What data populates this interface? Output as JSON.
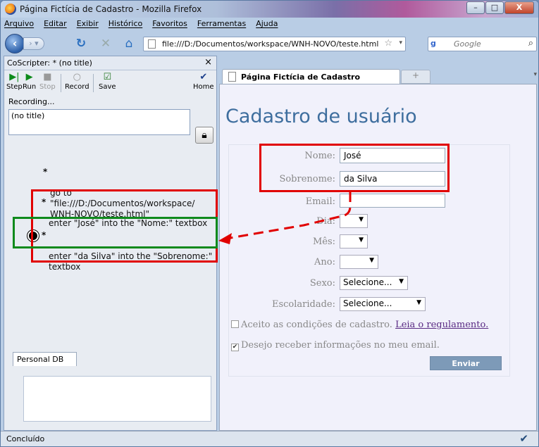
{
  "window": {
    "title": "Página Fictícia de Cadastro - Mozilla Firefox",
    "minimize": "–",
    "maximize": "□",
    "close": "X"
  },
  "menu": [
    "Arquivo",
    "Editar",
    "Exibir",
    "Histórico",
    "Favoritos",
    "Ferramentas",
    "Ajuda"
  ],
  "nav": {
    "url": "file:///D:/Documentos/workspace/WNH-NOVO/teste.html",
    "search_placeholder": "Google",
    "search_engine": "g"
  },
  "sidebar": {
    "title": "CoScripter: * (no title)",
    "close": "×",
    "toolbar": [
      {
        "label": "Step",
        "icon": "step-icon"
      },
      {
        "label": "Run",
        "icon": "run-icon"
      },
      {
        "label": "Stop",
        "icon": "stop-icon"
      },
      {
        "label": "Record",
        "icon": "record-icon"
      },
      {
        "label": "Save",
        "icon": "save-icon"
      },
      {
        "label": "Home",
        "icon": "home-icon"
      }
    ],
    "status": "Recording...",
    "script_title": "(no title)",
    "steps": [
      "go to \"file:///D:/Documentos/workspace/\nWNH-NOVO/teste.html\"",
      "enter \"José\" into the \"Nome:\" textbox",
      "enter \"da Silva\" into the \"Sobrenome:\"\ntextbox"
    ],
    "personal_db_tab": "Personal DB"
  },
  "tab": {
    "label": "Página Fictícia de Cadastro"
  },
  "page": {
    "title": "Cadastro de usuário",
    "fields": {
      "nome_label": "Nome:",
      "nome_value": "José",
      "sobrenome_label": "Sobrenome:",
      "sobrenome_value": "da Silva",
      "email_label": "Email:",
      "email_value": "",
      "dia_label": "Dia:",
      "mes_label": "Mês:",
      "ano_label": "Ano:",
      "sexo_label": "Sexo:",
      "sexo_value": "Selecione...",
      "escolaridade_label": "Escolaridade:",
      "escolaridade_value": "Selecione..."
    },
    "terms_text": "Aceito as condições de cadastro.",
    "terms_link": "Leia o regulamento.",
    "terms_checked": false,
    "newsletter_text": "Desejo receber informações no meu email.",
    "newsletter_checked": true,
    "submit": "Enviar"
  },
  "status": {
    "text": "Concluído"
  },
  "colors": {
    "highlight_red": "#e10000",
    "highlight_green": "#0f8a1c",
    "heading": "#3e6e9e",
    "submit_bg": "#7d9ab8"
  }
}
